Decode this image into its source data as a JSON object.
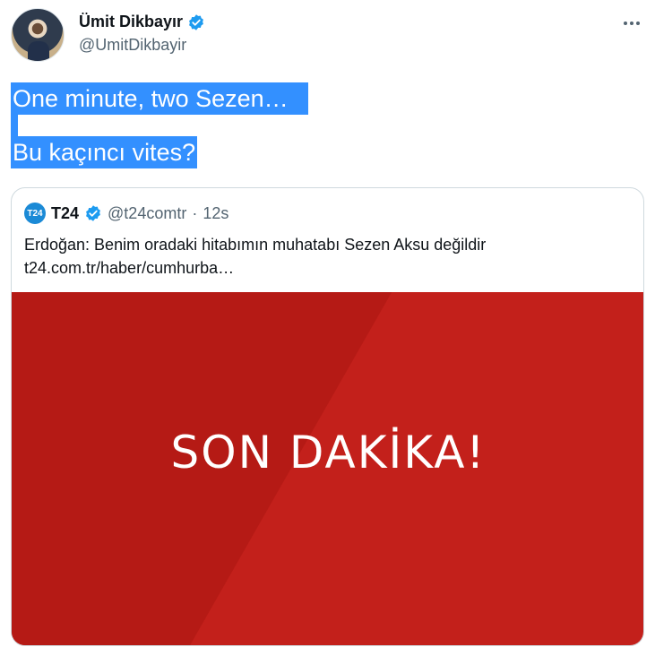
{
  "author": {
    "display_name": "Ümit Dikbayır",
    "handle": "@UmitDikbayir"
  },
  "tweet": {
    "line1": "One minute, two Sezen…",
    "line2": "Bu kaçıncı vites?"
  },
  "quote": {
    "logo_text": "T24",
    "name": "T24",
    "handle": "@t24comtr",
    "separator": "·",
    "time": "12s",
    "text_line1": "Erdoğan: Benim oradaki hitabımın muhatabı Sezen Aksu değildir",
    "text_line2": "t24.com.tr/haber/cumhurba…",
    "media_text": "SON DAKİKA!"
  },
  "colors": {
    "selection": "#3390ff",
    "verified": "#1d9bf0",
    "media_red": "#c3201b"
  },
  "icons": [
    "verified-badge-icon",
    "more-options-icon"
  ]
}
